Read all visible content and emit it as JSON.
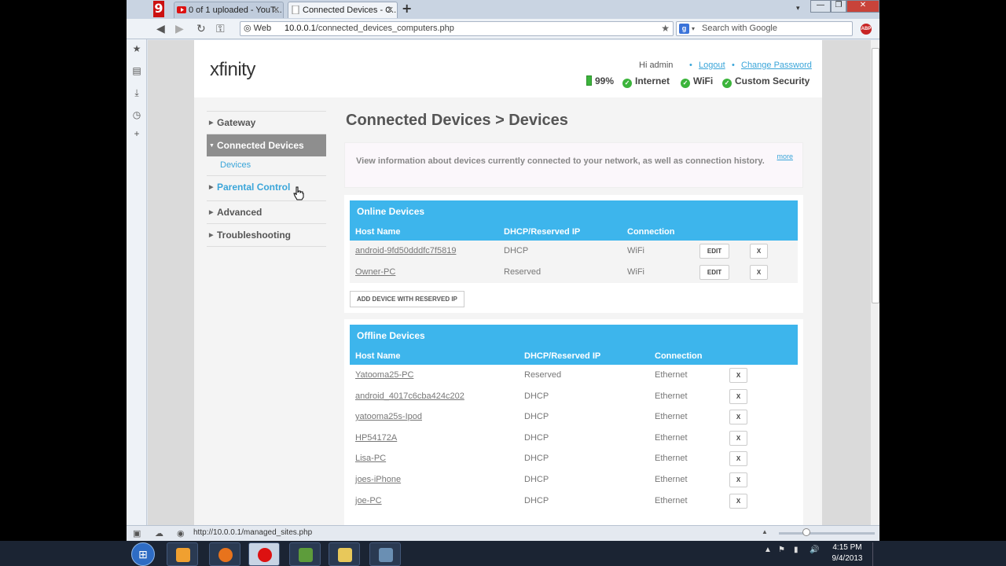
{
  "browser": {
    "tabs": [
      {
        "label": "0 of 1 uploaded - YouT...",
        "icon": "youtube-icon"
      },
      {
        "label": "Connected Devices - C...",
        "icon": "page-icon"
      }
    ],
    "address": {
      "prefix": "Web",
      "host": "10.0.0.1",
      "path": "/connected_devices_computers.php"
    },
    "search_placeholder": "Search with Google",
    "adblock_label": "ABP",
    "status_url": "http://10.0.0.1/managed_sites.php"
  },
  "header": {
    "logo": "xfinity",
    "greeting": "Hi admin",
    "logout": "Logout",
    "change_password": "Change Password",
    "battery": "99%",
    "status": [
      "Internet",
      "WiFi",
      "Custom Security"
    ]
  },
  "nav": {
    "gateway": "Gateway",
    "connected_devices": "Connected Devices",
    "devices": "Devices",
    "parental_control": "Parental Control",
    "advanced": "Advanced",
    "troubleshooting": "Troubleshooting"
  },
  "main": {
    "title": "Connected Devices > Devices",
    "info": "View information about devices currently connected to your network, as well as connection history.",
    "more": "more"
  },
  "online": {
    "title": "Online Devices",
    "columns": [
      "Host Name",
      "DHCP/Reserved IP",
      "Connection"
    ],
    "rows": [
      {
        "host": "android-9fd50dddfc7f5819",
        "ip": "DHCP",
        "conn": "WiFi"
      },
      {
        "host": "Owner-PC",
        "ip": "Reserved",
        "conn": "WiFi"
      }
    ],
    "edit": "EDIT",
    "remove": "X",
    "add_button": "ADD DEVICE WITH RESERVED IP"
  },
  "offline": {
    "title": "Offline Devices",
    "columns": [
      "Host Name",
      "DHCP/Reserved IP",
      "Connection"
    ],
    "rows": [
      {
        "host": "Yatooma25-PC",
        "ip": "Reserved",
        "conn": "Ethernet"
      },
      {
        "host": "android_4017c6cba424c202",
        "ip": "DHCP",
        "conn": "Ethernet"
      },
      {
        "host": "yatooma25s-Ipod",
        "ip": "DHCP",
        "conn": "Ethernet"
      },
      {
        "host": "HP54172A",
        "ip": "DHCP",
        "conn": "Ethernet"
      },
      {
        "host": "Lisa-PC",
        "ip": "DHCP",
        "conn": "Ethernet"
      },
      {
        "host": "joes-iPhone",
        "ip": "DHCP",
        "conn": "Ethernet"
      },
      {
        "host": "joe-PC",
        "ip": "DHCP",
        "conn": "Ethernet"
      }
    ],
    "remove": "X"
  },
  "taskbar": {
    "time": "4:15 PM",
    "date": "9/4/2013"
  },
  "colors": {
    "accent": "#3db5ec",
    "brand_red": "#d6001c",
    "ok_green": "#3bb43b"
  }
}
